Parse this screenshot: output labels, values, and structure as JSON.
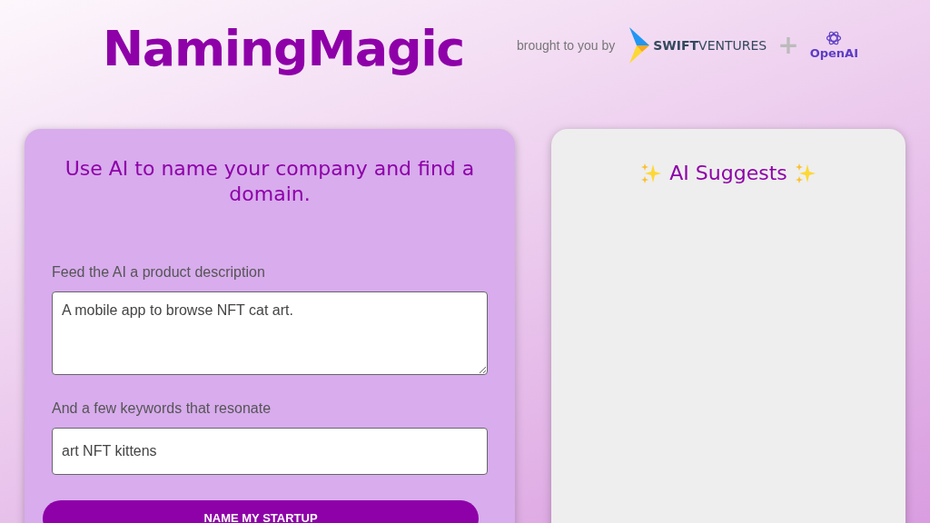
{
  "header": {
    "logo": "NamingMagic",
    "credit": "brought to you by",
    "sponsors": [
      {
        "kind": "swift",
        "bold": "SWIFT",
        "light": "VENTURES"
      },
      {
        "kind": "plus",
        "text": "+"
      },
      {
        "kind": "openai",
        "text": "OpenAI"
      }
    ]
  },
  "form": {
    "title": "Use AI to name your company and find a domain.",
    "fields": [
      {
        "kind": "textarea",
        "label": "Feed the AI a product description",
        "value": "A mobile app to browse NFT cat art."
      },
      {
        "kind": "input",
        "label": "And a few keywords that resonate",
        "value": "art NFT kittens"
      }
    ],
    "button": "NAME MY STARTUP"
  },
  "results": {
    "title": "AI Suggests"
  }
}
